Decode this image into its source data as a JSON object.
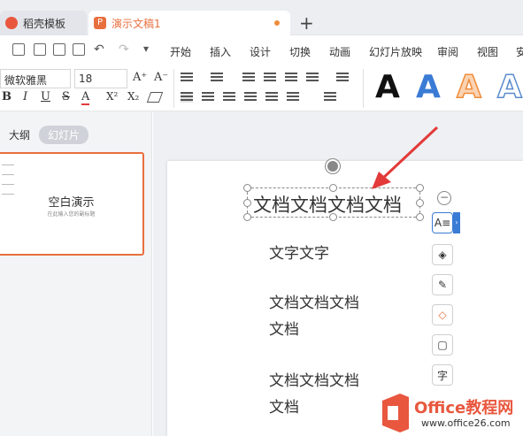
{
  "tabs": {
    "home": "稻壳模板",
    "doc": "演示文稿1",
    "new_tab_glyph": "+"
  },
  "menu": [
    "开始",
    "插入",
    "设计",
    "切换",
    "动画",
    "幻灯片放映",
    "审阅",
    "视图",
    "安"
  ],
  "ribbon": {
    "font_name": "微软雅黑",
    "font_size": "18",
    "bold": "B",
    "italic": "I",
    "underline": "U",
    "strike": "S",
    "font_color": "A",
    "superscript": "X²",
    "subscript": "X₂",
    "grow": "A⁺",
    "shrink": "A⁻",
    "art_letter": "A"
  },
  "left_panel": {
    "outline_tab": "大纲",
    "slides_tab": "幻灯片",
    "thumb_title": "空白演示",
    "thumb_subtitle": "在此输入您的副标题"
  },
  "slide": {
    "title": "文档文档文档文档",
    "body": [
      "文字文字",
      "文档文档文档文档",
      "文档文档文档文档"
    ]
  },
  "watermark": {
    "brand": "Office教程网",
    "url": "www.office26.com"
  },
  "colors": {
    "accent": "#e86f3e",
    "arrow": "#e33a3a",
    "art_blue": "#3a7bd5",
    "art_orange": "#f08c3a"
  }
}
